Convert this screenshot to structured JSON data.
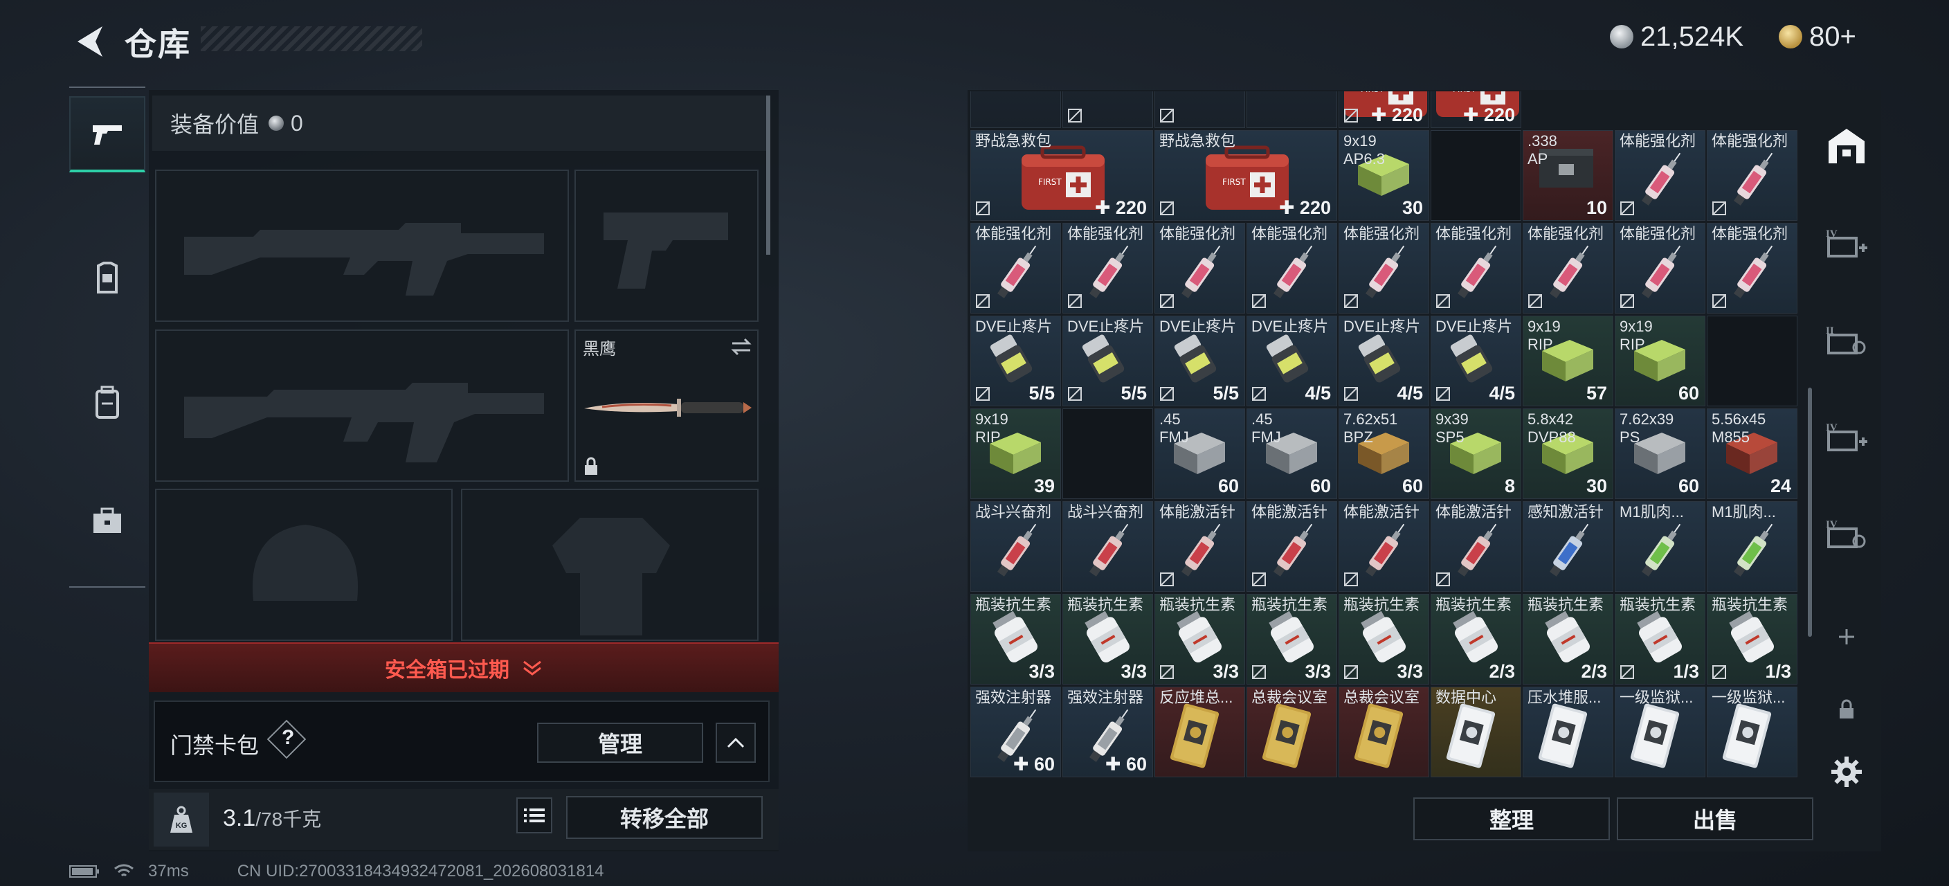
{
  "header": {
    "title": "仓库",
    "silver": "21,524K",
    "gold": "80+"
  },
  "left_sidebar": {
    "items": [
      "pistol-icon",
      "armor-rig-icon",
      "backpack-icon",
      "toolbox-icon"
    ]
  },
  "equipment": {
    "value_label": "装备价值",
    "value": "0",
    "knife_slot_label": "黑鹰",
    "safe_box_expired": "安全箱已过期",
    "keycard_label": "门禁卡包",
    "help": "?",
    "manage": "管理",
    "weight_value": "3.1",
    "weight_max": "/78千克",
    "transfer_all": "转移全部"
  },
  "status": {
    "ping": "37ms",
    "uid": "CN UID:27003318434932472081_202608031814"
  },
  "grid": {
    "rows": [
      [
        {
          "name": "",
          "count": "",
          "art": "",
          "bg": "dark",
          "nodrop": false
        },
        {
          "name": "",
          "count": "",
          "art": "",
          "bg": "dark",
          "nodrop": true
        },
        {
          "name": "",
          "count": "",
          "art": "",
          "bg": "dark",
          "nodrop": true
        },
        {
          "name": "",
          "count": "",
          "art": "",
          "bg": "dark",
          "nodrop": false
        },
        {
          "name": "",
          "count": "✚ 220",
          "art": "medkit",
          "bg": "dark",
          "nodrop": true
        },
        {
          "name": "",
          "count": "✚ 220",
          "art": "medkit",
          "bg": "dark",
          "nodrop": false
        }
      ],
      [
        {
          "name": "野战急救包",
          "count": "✚ 220",
          "art": "medkit",
          "bg": "blue",
          "nodrop": true,
          "wide": true
        },
        {
          "name": "野战急救包",
          "count": "✚ 220",
          "art": "medkit",
          "bg": "blue",
          "nodrop": true,
          "wide": true
        },
        {
          "name": "9x19\nAP6.3",
          "count": "30",
          "art": "ammo_green",
          "bg": "blue",
          "nodrop": false
        },
        {
          "name": "",
          "count": "",
          "art": "",
          "bg": "empty",
          "nodrop": false
        },
        {
          "name": ".338\nAP",
          "count": "10",
          "art": "ammo_box",
          "bg": "red",
          "nodrop": false
        },
        {
          "name": "体能强化剂",
          "count": "",
          "art": "syringe_pink",
          "bg": "blue",
          "nodrop": true
        },
        {
          "name": "体能强化剂",
          "count": "",
          "art": "syringe_pink",
          "bg": "blue",
          "nodrop": true
        }
      ],
      [
        {
          "name": "体能强化剂",
          "count": "",
          "art": "syringe_pink",
          "bg": "blue",
          "nodrop": true
        },
        {
          "name": "体能强化剂",
          "count": "",
          "art": "syringe_pink",
          "bg": "blue",
          "nodrop": true
        },
        {
          "name": "体能强化剂",
          "count": "",
          "art": "syringe_pink",
          "bg": "blue",
          "nodrop": true
        },
        {
          "name": "体能强化剂",
          "count": "",
          "art": "syringe_pink",
          "bg": "blue",
          "nodrop": true
        },
        {
          "name": "体能强化剂",
          "count": "",
          "art": "syringe_pink",
          "bg": "blue",
          "nodrop": true
        },
        {
          "name": "体能强化剂",
          "count": "",
          "art": "syringe_pink",
          "bg": "blue",
          "nodrop": true
        },
        {
          "name": "体能强化剂",
          "count": "",
          "art": "syringe_pink",
          "bg": "blue",
          "nodrop": true
        },
        {
          "name": "体能强化剂",
          "count": "",
          "art": "syringe_pink",
          "bg": "blue",
          "nodrop": true
        },
        {
          "name": "体能强化剂",
          "count": "",
          "art": "syringe_pink",
          "bg": "blue",
          "nodrop": true
        }
      ],
      [
        {
          "name": "DVE止疼片",
          "count": "5/5",
          "art": "pills",
          "bg": "blue",
          "nodrop": true
        },
        {
          "name": "DVE止疼片",
          "count": "5/5",
          "art": "pills",
          "bg": "blue",
          "nodrop": true
        },
        {
          "name": "DVE止疼片",
          "count": "5/5",
          "art": "pills",
          "bg": "blue",
          "nodrop": true
        },
        {
          "name": "DVE止疼片",
          "count": "4/5",
          "art": "pills",
          "bg": "blue",
          "nodrop": true
        },
        {
          "name": "DVE止疼片",
          "count": "4/5",
          "art": "pills",
          "bg": "blue",
          "nodrop": true
        },
        {
          "name": "DVE止疼片",
          "count": "4/5",
          "art": "pills",
          "bg": "blue",
          "nodrop": true
        },
        {
          "name": "9x19\nRIP",
          "count": "57",
          "art": "ammo_green",
          "bg": "green",
          "nodrop": false
        },
        {
          "name": "9x19\nRIP",
          "count": "60",
          "art": "ammo_green",
          "bg": "green",
          "nodrop": false
        },
        {
          "name": "",
          "count": "",
          "art": "",
          "bg": "empty",
          "nodrop": false
        }
      ],
      [
        {
          "name": "9x19\nRIP",
          "count": "39",
          "art": "ammo_green",
          "bg": "green",
          "nodrop": false
        },
        {
          "name": "",
          "count": "",
          "art": "",
          "bg": "empty",
          "nodrop": false
        },
        {
          "name": ".45\nFMJ",
          "count": "60",
          "art": "ammo_gray",
          "bg": "blue",
          "nodrop": false
        },
        {
          "name": ".45\nFMJ",
          "count": "60",
          "art": "ammo_gray",
          "bg": "blue",
          "nodrop": false
        },
        {
          "name": "7.62x51\nBPZ",
          "count": "60",
          "art": "ammo_brown",
          "bg": "blue",
          "nodrop": false
        },
        {
          "name": "9x39\nSP5",
          "count": "8",
          "art": "ammo_green",
          "bg": "green",
          "nodrop": false
        },
        {
          "name": "5.8x42\nDVP88",
          "count": "30",
          "art": "ammo_green",
          "bg": "green",
          "nodrop": false
        },
        {
          "name": "7.62x39\nPS",
          "count": "60",
          "art": "ammo_gray",
          "bg": "blue",
          "nodrop": false
        },
        {
          "name": "5.56x45\nM855",
          "count": "24",
          "art": "ammo_red",
          "bg": "blue",
          "nodrop": false
        }
      ],
      [
        {
          "name": "战斗兴奋剂",
          "count": "",
          "art": "syringe_red",
          "bg": "blue",
          "nodrop": false
        },
        {
          "name": "战斗兴奋剂",
          "count": "",
          "art": "syringe_red",
          "bg": "blue",
          "nodrop": false
        },
        {
          "name": "体能激活针",
          "count": "",
          "art": "syringe_red",
          "bg": "blue",
          "nodrop": true
        },
        {
          "name": "体能激活针",
          "count": "",
          "art": "syringe_red",
          "bg": "blue",
          "nodrop": true
        },
        {
          "name": "体能激活针",
          "count": "",
          "art": "syringe_red",
          "bg": "blue",
          "nodrop": true
        },
        {
          "name": "体能激活针",
          "count": "",
          "art": "syringe_red",
          "bg": "blue",
          "nodrop": true
        },
        {
          "name": "感知激活针",
          "count": "",
          "art": "syringe_blue",
          "bg": "blue",
          "nodrop": false
        },
        {
          "name": "M1肌肉...",
          "count": "",
          "art": "syringe_green",
          "bg": "blue",
          "nodrop": false
        },
        {
          "name": "M1肌肉...",
          "count": "",
          "art": "syringe_green",
          "bg": "blue",
          "nodrop": false
        }
      ],
      [
        {
          "name": "瓶装抗生素",
          "count": "3/3",
          "art": "bottle",
          "bg": "green",
          "nodrop": false
        },
        {
          "name": "瓶装抗生素",
          "count": "3/3",
          "art": "bottle",
          "bg": "green",
          "nodrop": false
        },
        {
          "name": "瓶装抗生素",
          "count": "3/3",
          "art": "bottle",
          "bg": "green",
          "nodrop": true
        },
        {
          "name": "瓶装抗生素",
          "count": "3/3",
          "art": "bottle",
          "bg": "green",
          "nodrop": true
        },
        {
          "name": "瓶装抗生素",
          "count": "3/3",
          "art": "bottle",
          "bg": "green",
          "nodrop": true
        },
        {
          "name": "瓶装抗生素",
          "count": "2/3",
          "art": "bottle",
          "bg": "green",
          "nodrop": false
        },
        {
          "name": "瓶装抗生素",
          "count": "2/3",
          "art": "bottle",
          "bg": "green",
          "nodrop": false
        },
        {
          "name": "瓶装抗生素",
          "count": "1/3",
          "art": "bottle",
          "bg": "green",
          "nodrop": true
        },
        {
          "name": "瓶装抗生素",
          "count": "1/3",
          "art": "bottle",
          "bg": "green",
          "nodrop": true
        }
      ],
      [
        {
          "name": "强效注射器",
          "count": "✚ 60",
          "art": "syringe_white",
          "bg": "blue",
          "nodrop": false
        },
        {
          "name": "强效注射器",
          "count": "✚ 60",
          "art": "syringe_white",
          "bg": "blue",
          "nodrop": false
        },
        {
          "name": "反应堆总...",
          "count": "",
          "art": "card_gold",
          "bg": "red",
          "nodrop": false
        },
        {
          "name": "总裁会议室",
          "count": "",
          "art": "card_gold",
          "bg": "red",
          "nodrop": false
        },
        {
          "name": "总裁会议室",
          "count": "",
          "art": "card_gold",
          "bg": "red",
          "nodrop": false
        },
        {
          "name": "数据中心",
          "count": "",
          "art": "card_white",
          "bg": "gold",
          "nodrop": false
        },
        {
          "name": "压水堆服...",
          "count": "",
          "art": "card_white",
          "bg": "blue",
          "nodrop": false
        },
        {
          "name": "一级监狱...",
          "count": "",
          "art": "card_white",
          "bg": "blue",
          "nodrop": false
        },
        {
          "name": "一级监狱...",
          "count": "",
          "art": "card_white",
          "bg": "blue",
          "nodrop": false
        }
      ]
    ]
  },
  "right_actions": {
    "sort": "整理",
    "sell": "出售"
  },
  "right_sidebar": {
    "items": [
      "warehouse-icon",
      "expand-iv-icon",
      "expand-ii-icon",
      "expand-iv-icon-2",
      "expand-iv-icon-3",
      "add-icon",
      "lock-icon",
      "settings-icon"
    ]
  },
  "colors": {
    "accent": "#2ed0a8",
    "danger": "#ff5a4f"
  }
}
